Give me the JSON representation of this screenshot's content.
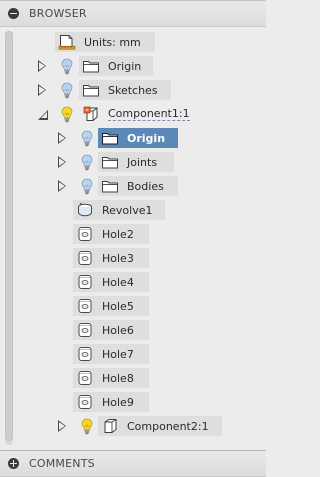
{
  "browser": {
    "title": "BROWSER",
    "comments_title": "COMMENTS",
    "units_label": "Units: mm",
    "items": {
      "origin": "Origin",
      "sketches": "Sketches",
      "component1": "Component1:1",
      "comp_origin": "Origin",
      "joints": "Joints",
      "bodies": "Bodies",
      "revolve1": "Revolve1",
      "hole2": "Hole2",
      "hole3": "Hole3",
      "hole4": "Hole4",
      "hole5": "Hole5",
      "hole6": "Hole6",
      "hole7": "Hole7",
      "hole8": "Hole8",
      "hole9": "Hole9",
      "component2": "Component2:1"
    }
  },
  "colors": {
    "selection": "#5b88b6",
    "bulb_on": "#f2d230",
    "bulb_off": "#a9c8e8",
    "item_bg": "#dedede"
  }
}
